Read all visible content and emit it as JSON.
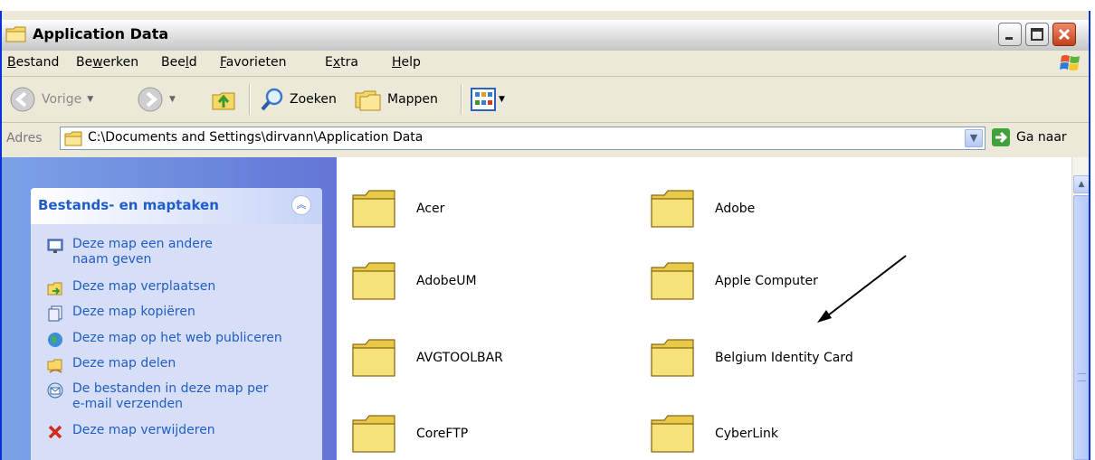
{
  "window": {
    "title": "Application Data",
    "icon": "folder-icon",
    "controls": [
      "minimize-button",
      "maximize-button",
      "close-button"
    ]
  },
  "menu": {
    "items": [
      {
        "key": "B",
        "rest": "estand"
      },
      {
        "pre": "Be",
        "key": "w",
        "rest": "erken"
      },
      {
        "pre": "Bee",
        "key": "l",
        "rest": "d"
      },
      {
        "key": "F",
        "rest": "avorieten"
      },
      {
        "pre": "E",
        "key": "x",
        "rest": "tra"
      },
      {
        "key": "H",
        "rest": "elp"
      }
    ]
  },
  "toolbar": {
    "back_label": "Vorige",
    "search_label": "Zoeken",
    "folders_label": "Mappen"
  },
  "address": {
    "label": "Adres",
    "path": "C:\\Documents and Settings\\dirvann\\Application Data",
    "go_label": "Ga naar"
  },
  "tasks_panel": {
    "title": "Bestands- en maptaken",
    "items": [
      {
        "label": "Deze map een andere naam geven",
        "icon": "rename-icon"
      },
      {
        "label": "Deze map verplaatsen",
        "icon": "move-icon"
      },
      {
        "label": "Deze map kopiëren",
        "icon": "copy-icon"
      },
      {
        "label": "Deze map op het web publiceren",
        "icon": "web-publish-icon"
      },
      {
        "label": "Deze map delen",
        "icon": "share-icon"
      },
      {
        "label": "De bestanden in deze map per e-mail verzenden",
        "icon": "email-icon"
      },
      {
        "label": "Deze map verwijderen",
        "icon": "delete-icon"
      }
    ]
  },
  "folders": [
    {
      "name": "Acer"
    },
    {
      "name": "Adobe"
    },
    {
      "name": "AdobeUM"
    },
    {
      "name": "Apple Computer"
    },
    {
      "name": "AVGTOOLBAR"
    },
    {
      "name": "Belgium Identity Card"
    },
    {
      "name": "CoreFTP"
    },
    {
      "name": "CyberLink"
    }
  ],
  "colors": {
    "title_blue": "#0831D9",
    "panel_blue": "#7BA2E7",
    "link_blue": "#215DC6",
    "folder_yellow": "#F6E27A"
  }
}
